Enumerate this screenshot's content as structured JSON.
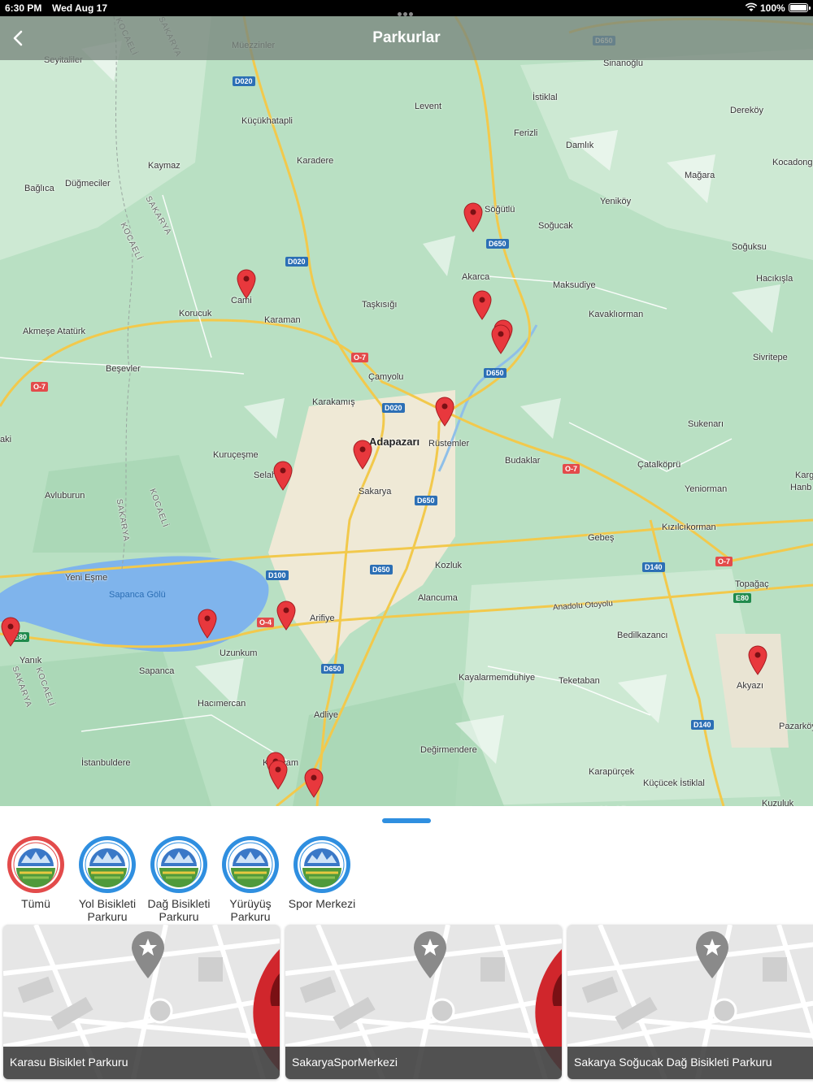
{
  "status": {
    "time": "6:30 PM",
    "date": "Wed Aug 17",
    "battery": "100%"
  },
  "header": {
    "title": "Parkurlar"
  },
  "map": {
    "places": [
      "Müezzinler",
      "Seyitaliler",
      "Küçükhatapli",
      "Kaymaz",
      "Düğmeciler",
      "Bağlıca",
      "Karadere",
      "Levent",
      "İstiklal",
      "Sinanoğlu",
      "Dereköy",
      "Ferizli",
      "Damlık",
      "Kocadong",
      "Mağara",
      "Söğütlü",
      "Yeniköy",
      "Soğucak",
      "Soğuksu",
      "Akarca",
      "Maksudiye",
      "Hacıkışla",
      "Korucuk",
      "Karaman",
      "Taşkısığı",
      "Kavaklıorman",
      "Akmeşe Atatürk",
      "Beşevler",
      "Çamyolu",
      "Sivritepe",
      "Karakamış",
      "Rüstemler",
      "Sukenarı",
      "Kuruçeşme",
      "Budaklar",
      "Çatalköprü",
      "Selahiye",
      "Sakarya",
      "Yeniorman",
      "Avluburun",
      "Gebeş",
      "Kızılcıkorman",
      "Yeni Eşme",
      "Kozluk",
      "Topağaç",
      "Alancuma",
      "Arifiye",
      "Bedilkazancı",
      "Yanık",
      "Sapanca",
      "Uzunkum",
      "Kayalarmemduhiye",
      "Teketaban",
      "Akyazı",
      "Hacımercan",
      "Adliye",
      "Pazarköy",
      "İstanbuldere",
      "Değirmendere",
      "Karaçam",
      "Karapürçek",
      "Küçücek İstiklal",
      "Mecidiye",
      "Kuzuluk",
      "Cami",
      "Karg",
      "Hanb",
      "aki"
    ],
    "city": "Adapazarı",
    "lake": "Sapanca Gölü",
    "highway": "Anadolu Otoyolu",
    "regions": [
      "KOCAELİ",
      "SAKARYA",
      "SAKARYA",
      "KOCAELİ",
      "KOCAELİ",
      "SAKARYA",
      "KOCAELİ",
      "SAKARYA"
    ],
    "roads": [
      "D650",
      "D020",
      "D020",
      "D020",
      "O-7",
      "O-7",
      "O-7",
      "O-7",
      "D650",
      "D650",
      "D650",
      "D650",
      "D100",
      "O-4",
      "D140",
      "D140",
      "E80",
      "E80",
      "D650"
    ]
  },
  "categories": [
    {
      "label": "Tümü",
      "color": "#e34b4b"
    },
    {
      "label": "Yol Bisikleti Parkuru",
      "color": "#2f8fe0"
    },
    {
      "label": "Dağ Bisikleti Parkuru",
      "color": "#2f8fe0"
    },
    {
      "label": "Yürüyüş Parkuru",
      "color": "#2f8fe0"
    },
    {
      "label": "Spor Merkezi",
      "color": "#2f8fe0"
    }
  ],
  "cards": [
    {
      "title": "Karasu Bisiklet Parkuru"
    },
    {
      "title": "SakaryaSporMerkezi"
    },
    {
      "title": "Sakarya Soğucak Dağ Bisikleti Parkuru"
    }
  ]
}
